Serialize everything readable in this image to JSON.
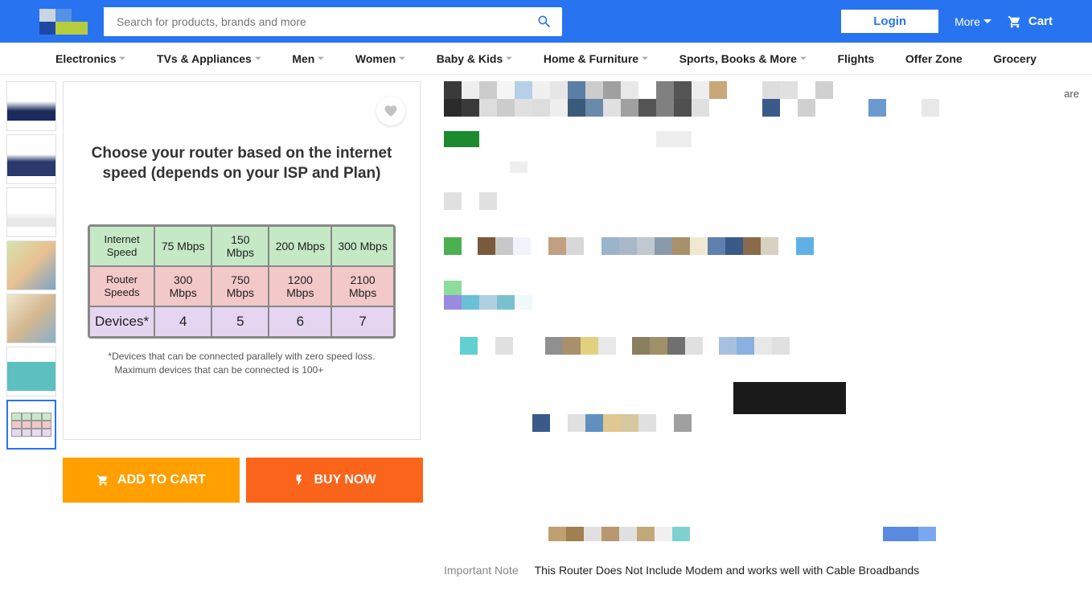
{
  "header": {
    "search_placeholder": "Search for products, brands and more",
    "login": "Login",
    "more": "More",
    "cart": "Cart"
  },
  "nav": {
    "items": [
      "Electronics",
      "TVs & Appliances",
      "Men",
      "Women",
      "Baby & Kids",
      "Home & Furniture",
      "Sports, Books & More",
      "Flights",
      "Offer Zone",
      "Grocery"
    ]
  },
  "share_label": "are",
  "image_panel": {
    "title": "Choose your router based on the internet speed (depends on your ISP and Plan)",
    "table": {
      "row_headers": [
        "Internet Speed",
        "Router Speeds",
        "Devices*"
      ],
      "cols": [
        {
          "speed": "75 Mbps",
          "router": "300 Mbps",
          "devices": "4"
        },
        {
          "speed": "150 Mbps",
          "router": "750 Mbps",
          "devices": "5"
        },
        {
          "speed": "200 Mbps",
          "router": "1200 Mbps",
          "devices": "6"
        },
        {
          "speed": "300 Mbps",
          "router": "2100 Mbps",
          "devices": "7"
        }
      ]
    },
    "note_line1": "*Devices that can be connected parallely with zero speed loss.",
    "note_line2": "Maximum devices that can be connected is 100+"
  },
  "cta": {
    "add_to_cart": "ADD TO CART",
    "buy_now": "BUY NOW"
  },
  "important": {
    "label": "Important Note",
    "text": "This Router Does Not Include Modem and works well with Cable Broadbands"
  }
}
